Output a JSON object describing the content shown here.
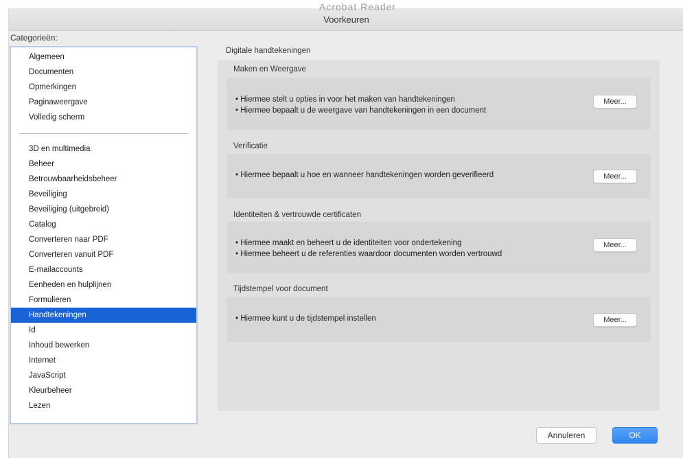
{
  "window": {
    "ghost_title": "Acrobat Reader",
    "title": "Voorkeuren"
  },
  "sidebar": {
    "label": "Categorieën:",
    "items": [
      {
        "label": "Algemeen"
      },
      {
        "label": "Documenten"
      },
      {
        "label": "Opmerkingen"
      },
      {
        "label": "Paginaweergave"
      },
      {
        "label": "Volledig scherm"
      },
      {
        "label": "3D en multimedia"
      },
      {
        "label": "Beheer"
      },
      {
        "label": "Betrouwbaarheidsbeheer"
      },
      {
        "label": "Beveiliging"
      },
      {
        "label": "Beveiliging (uitgebreid)"
      },
      {
        "label": "Catalog"
      },
      {
        "label": "Converteren naar PDF"
      },
      {
        "label": "Converteren vanuit PDF"
      },
      {
        "label": "E-mailaccounts"
      },
      {
        "label": "Eenheden en hulplijnen"
      },
      {
        "label": "Formulieren"
      },
      {
        "label": "Handtekeningen",
        "selected": true
      },
      {
        "label": "Id"
      },
      {
        "label": "Inhoud bewerken"
      },
      {
        "label": "Internet"
      },
      {
        "label": "JavaScript"
      },
      {
        "label": "Kleurbeheer"
      },
      {
        "label": "Lezen"
      }
    ]
  },
  "main": {
    "section_title": "Digitale handtekeningen",
    "groups": [
      {
        "title": "Maken en Weergave",
        "lines": [
          "• Hiermee stelt u opties in voor het maken van handtekeningen",
          "• Hiermee bepaalt u de weergave van handtekeningen in een document"
        ],
        "button": "Meer..."
      },
      {
        "title": "Verificatie",
        "lines": [
          "• Hiermee bepaalt u hoe en wanneer handtekeningen worden geverifieerd"
        ],
        "button": "Meer..."
      },
      {
        "title": "Identiteiten & vertrouwde certificaten",
        "lines": [
          "• Hiermee maakt en beheert u de identiteiten voor ondertekening",
          "• Hiermee beheert u de referenties waardoor documenten worden vertrouwd"
        ],
        "button": "Meer..."
      },
      {
        "title": "Tijdstempel voor document",
        "lines": [
          "• Hiermee kunt u de tijdstempel instellen"
        ],
        "button": "Meer..."
      }
    ]
  },
  "footer": {
    "cancel_label": "Annuleren",
    "ok_label": "OK"
  },
  "colors": {
    "selection": "#1a63d6",
    "ok_button": "#3a8ef5"
  }
}
